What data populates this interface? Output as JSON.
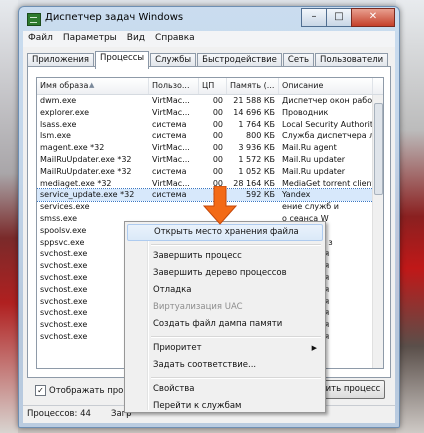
{
  "window": {
    "title": "Диспетчер задач Windows",
    "btn_minimize": "–",
    "btn_maximize": "□",
    "btn_close": "✕"
  },
  "menu": [
    "Файл",
    "Параметры",
    "Вид",
    "Справка"
  ],
  "tabs": [
    "Приложения",
    "Процессы",
    "Службы",
    "Быстродействие",
    "Сеть",
    "Пользователи"
  ],
  "active_tab": "Процессы",
  "columns": [
    "Имя образа",
    "Пользо...",
    "ЦП",
    "Память (...",
    "Описание"
  ],
  "rows": [
    {
      "name": "dwm.exe",
      "user": "VirtMac...",
      "cpu": "00",
      "mem": "21 588 КБ",
      "desc": "Диспетчер окон рабо"
    },
    {
      "name": "explorer.exe",
      "user": "VirtMac...",
      "cpu": "00",
      "mem": "14 696 КБ",
      "desc": "Проводник"
    },
    {
      "name": "lsass.exe",
      "user": "система",
      "cpu": "00",
      "mem": "1 764 КБ",
      "desc": "Local Security Authorit"
    },
    {
      "name": "lsm.exe",
      "user": "система",
      "cpu": "00",
      "mem": "800 КБ",
      "desc": "Служба диспетчера л"
    },
    {
      "name": "magent.exe *32",
      "user": "VirtMac...",
      "cpu": "00",
      "mem": "3 936 КБ",
      "desc": "Mail.Ru agent"
    },
    {
      "name": "MailRuUpdater.exe *32",
      "user": "VirtMac...",
      "cpu": "00",
      "mem": "1 572 КБ",
      "desc": "Mail.Ru updater"
    },
    {
      "name": "MailRuUpdater.exe *32",
      "user": "система",
      "cpu": "00",
      "mem": "1 052 КБ",
      "desc": "Mail.Ru updater"
    },
    {
      "name": "mediaget.exe *32",
      "user": "VirtMac...",
      "cpu": "00",
      "mem": "28 164 КБ",
      "desc": "MediaGet torrent client"
    },
    {
      "name": "service_update.exe *32",
      "user": "система",
      "cpu": "00",
      "mem": "592 КБ",
      "desc": "Yandex"
    },
    {
      "name": "services.exe",
      "user": "",
      "cpu": "",
      "mem": "",
      "desc": "ение служб и"
    },
    {
      "name": "smss.exe",
      "user": "",
      "cpu": "",
      "mem": "",
      "desc": "о сеанса W"
    },
    {
      "name": "spoolsv.exe",
      "user": "",
      "cpu": "",
      "mem": "",
      "desc": "ечатки"
    },
    {
      "name": "sppsvc.exe",
      "user": "",
      "cpu": "",
      "mem": "",
      "desc": "латформы з"
    },
    {
      "name": "svchost.exe",
      "user": "",
      "cpu": "",
      "mem": "",
      "desc": "роцесс для"
    },
    {
      "name": "svchost.exe",
      "user": "",
      "cpu": "",
      "mem": "",
      "desc": "роцесс для"
    },
    {
      "name": "svchost.exe",
      "user": "",
      "cpu": "",
      "mem": "",
      "desc": "роцесс для"
    },
    {
      "name": "svchost.exe",
      "user": "",
      "cpu": "",
      "mem": "",
      "desc": "роцесс для"
    },
    {
      "name": "svchost.exe",
      "user": "",
      "cpu": "",
      "mem": "",
      "desc": "роцесс для"
    },
    {
      "name": "svchost.exe",
      "user": "",
      "cpu": "",
      "mem": "",
      "desc": "роцесс для"
    },
    {
      "name": "svchost.exe",
      "user": "",
      "cpu": "",
      "mem": "",
      "desc": "роцесс для"
    },
    {
      "name": "svchost.exe",
      "user": "",
      "cpu": "",
      "mem": "",
      "desc": "роцесс для"
    }
  ],
  "selected_row": 8,
  "show_all_label": "Отображать процес",
  "show_all_checked": "✓",
  "end_process_label": "ить процесс",
  "status": {
    "processes": "Процессов: 44",
    "cpu": "Загр"
  },
  "context_menu": [
    {
      "label": "Открыть место хранения файла",
      "hover": true
    },
    {
      "sep": true
    },
    {
      "label": "Завершить процесс"
    },
    {
      "label": "Завершить дерево процессов"
    },
    {
      "label": "Отладка"
    },
    {
      "label": "Виртуализация UAC",
      "disabled": true
    },
    {
      "label": "Создать файл дампа памяти"
    },
    {
      "sep": true
    },
    {
      "label": "Приоритет",
      "submenu": true
    },
    {
      "label": "Задать соответствие..."
    },
    {
      "sep": true
    },
    {
      "label": "Свойства"
    },
    {
      "label": "Перейти к службам"
    }
  ],
  "colors": {
    "pointer_arrow": "#f36a16",
    "selection": "#d7e8fb"
  },
  "icons": {
    "pointer": "orange-arrow-icon",
    "submenu": "chevron-right-icon",
    "sort": "sort-up-icon"
  }
}
